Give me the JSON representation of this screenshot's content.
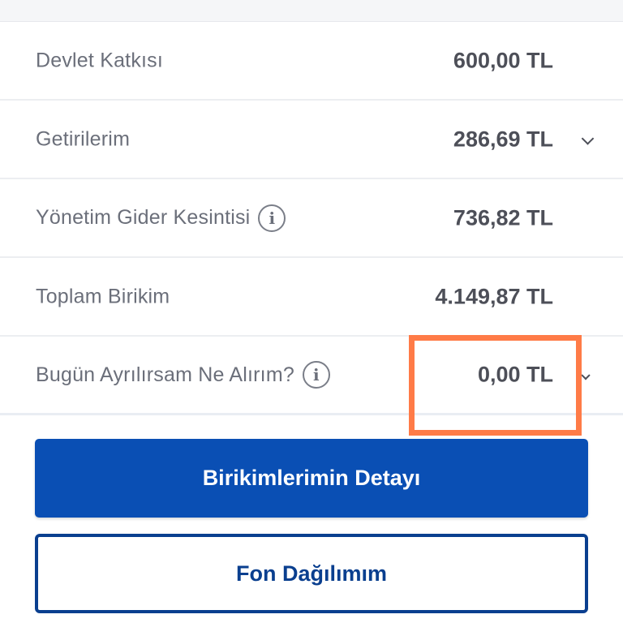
{
  "rows": [
    {
      "label": "Devlet Katkısı",
      "value": "600,00 TL"
    },
    {
      "label": "Getirilerim",
      "value": "286,69 TL"
    },
    {
      "label": "Yönetim Gider Kesintisi",
      "value": "736,82 TL"
    },
    {
      "label": "Toplam Birikim",
      "value": "4.149,87 TL"
    },
    {
      "label": "Bugün Ayrılırsam Ne Alırım?",
      "value": "0,00 TL"
    }
  ],
  "info_glyph": "i",
  "buttons": {
    "primary_label": "Birikimlerimin Detayı",
    "secondary_label": "Fon Dağılımım"
  },
  "colors": {
    "primary_blue": "#0a4fb4",
    "outline_blue": "#0a3f8f",
    "highlight_orange": "#ff7b47",
    "value_text": "#4d4f58",
    "label_text": "#6b6f7a"
  },
  "icons": {
    "info": "info-circle-icon",
    "expand": "chevron-down-icon"
  }
}
